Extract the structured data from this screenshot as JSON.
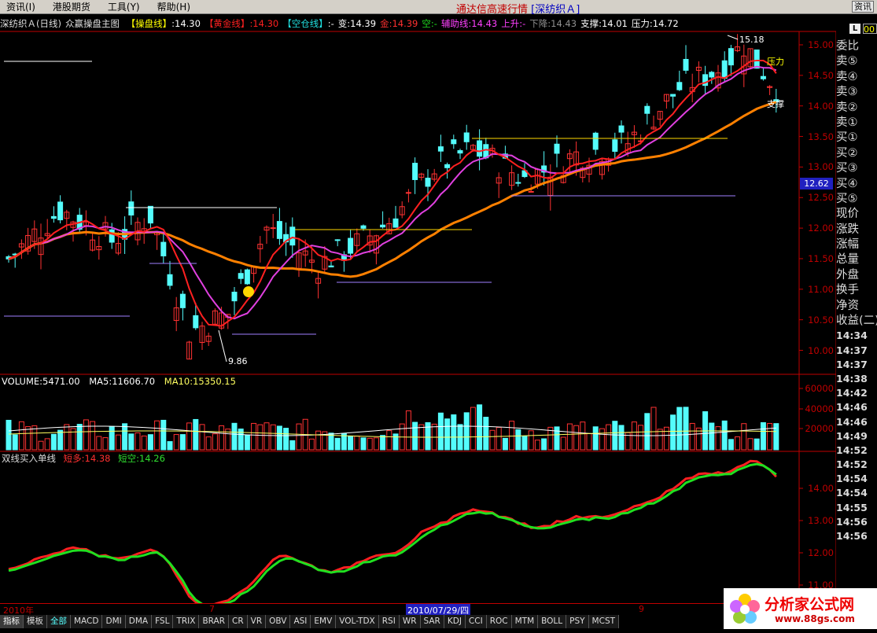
{
  "menu": {
    "items": [
      "资讯(I)",
      "港股期货",
      "工具(Y)",
      "帮助(H)"
    ],
    "app_title": "通达信高速行情",
    "stock_title": "[深纺织Ａ]",
    "corner_button": "资讯"
  },
  "infobar": {
    "stock": "深纺织Ａ(日线)",
    "indicator": "众赢操盘主图",
    "items": [
      {
        "label": "【操盘线】",
        "value": ":14.30",
        "color": "#ffff00",
        "vcolor": "#ffffff"
      },
      {
        "label": "【黄金线】",
        "value": ":14.30",
        "color": "#ff2020",
        "vcolor": "#ff2020"
      },
      {
        "label": "【空仓线】",
        "value": ":-",
        "color": "#20e0e0",
        "vcolor": "#ffffff"
      },
      {
        "label": "变:",
        "value": "14.39",
        "color": "#ffffff",
        "vcolor": "#ffffff"
      },
      {
        "label": "金:",
        "value": "14.39",
        "color": "#ff3030",
        "vcolor": "#ff3030"
      },
      {
        "label": "空:",
        "value": "-",
        "color": "#20e020",
        "vcolor": "#20e020"
      },
      {
        "label": "辅助线:",
        "value": "14.43",
        "color": "#ff40ff",
        "vcolor": "#ff40ff"
      },
      {
        "label": "上升:",
        "value": "-",
        "color": "#ff40ff",
        "vcolor": "#ff40ff"
      },
      {
        "label": "下降:",
        "value": "14.43",
        "color": "#909090",
        "vcolor": "#909090"
      },
      {
        "label": "支撑:",
        "value": "14.01",
        "color": "#ffffff",
        "vcolor": "#ffffff"
      },
      {
        "label": "压力:",
        "value": "14.72",
        "color": "#ffffff",
        "vcolor": "#ffffff"
      }
    ]
  },
  "volume_header": {
    "vol": "VOLUME:5471.00",
    "ma5": "MA5:11606.70",
    "ma10": "MA10:15350.15"
  },
  "indicator_header": {
    "name": "双线买入单线",
    "long": "短多:14.38",
    "short": "短空:14.26"
  },
  "annotations": {
    "high": "15.18",
    "low": "9.86",
    "pressure": "压力",
    "support": "支撑",
    "current_price": "12.62"
  },
  "price_axis": [
    "15.00",
    "14.50",
    "14.00",
    "13.50",
    "13.00",
    "12.50",
    "12.00",
    "11.50",
    "11.00",
    "10.50",
    "10.00"
  ],
  "volume_axis": [
    "60000",
    "40000",
    "20000"
  ],
  "indicator_axis": [
    "14.00",
    "13.00",
    "12.00",
    "11.00"
  ],
  "date_labels": [
    "2010年",
    "7",
    "2010/07/29/四",
    "9"
  ],
  "side_panel": {
    "labels": [
      "委比",
      "卖⑤",
      "卖④",
      "卖③",
      "卖②",
      "卖①",
      "买①",
      "买②",
      "买③",
      "买④",
      "买⑤",
      "现价",
      "涨跌",
      "涨幅",
      "总量",
      "外盘",
      "换手",
      "净资",
      "收益(二)"
    ],
    "times": [
      "14:34",
      "14:37",
      "14:37",
      "14:38",
      "14:42",
      "14:46",
      "14:46",
      "14:49",
      "14:52",
      "14:52",
      "14:54",
      "14:54",
      "14:55",
      "14:56",
      "14:56"
    ],
    "btn_l": "L",
    "btn_code": "00"
  },
  "tabs": [
    "指标",
    "模板",
    "全部",
    "MACD",
    "DMI",
    "DMA",
    "FSL",
    "TRIX",
    "BRAR",
    "CR",
    "VR",
    "OBV",
    "ASI",
    "EMV",
    "VOL-TDX",
    "RSI",
    "WR",
    "SAR",
    "KDJ",
    "CCI",
    "ROC",
    "MTM",
    "BOLL",
    "PSY",
    "MCST"
  ],
  "watermark": {
    "title": "分析家公式网",
    "url": "www.88gs.com"
  },
  "colors": {
    "up": "#ff3232",
    "down": "#54fcfc",
    "axis": "#c00000",
    "ma_short": "#ff2020",
    "ma_long": "#ff8000",
    "assist": "#e040e0"
  }
}
